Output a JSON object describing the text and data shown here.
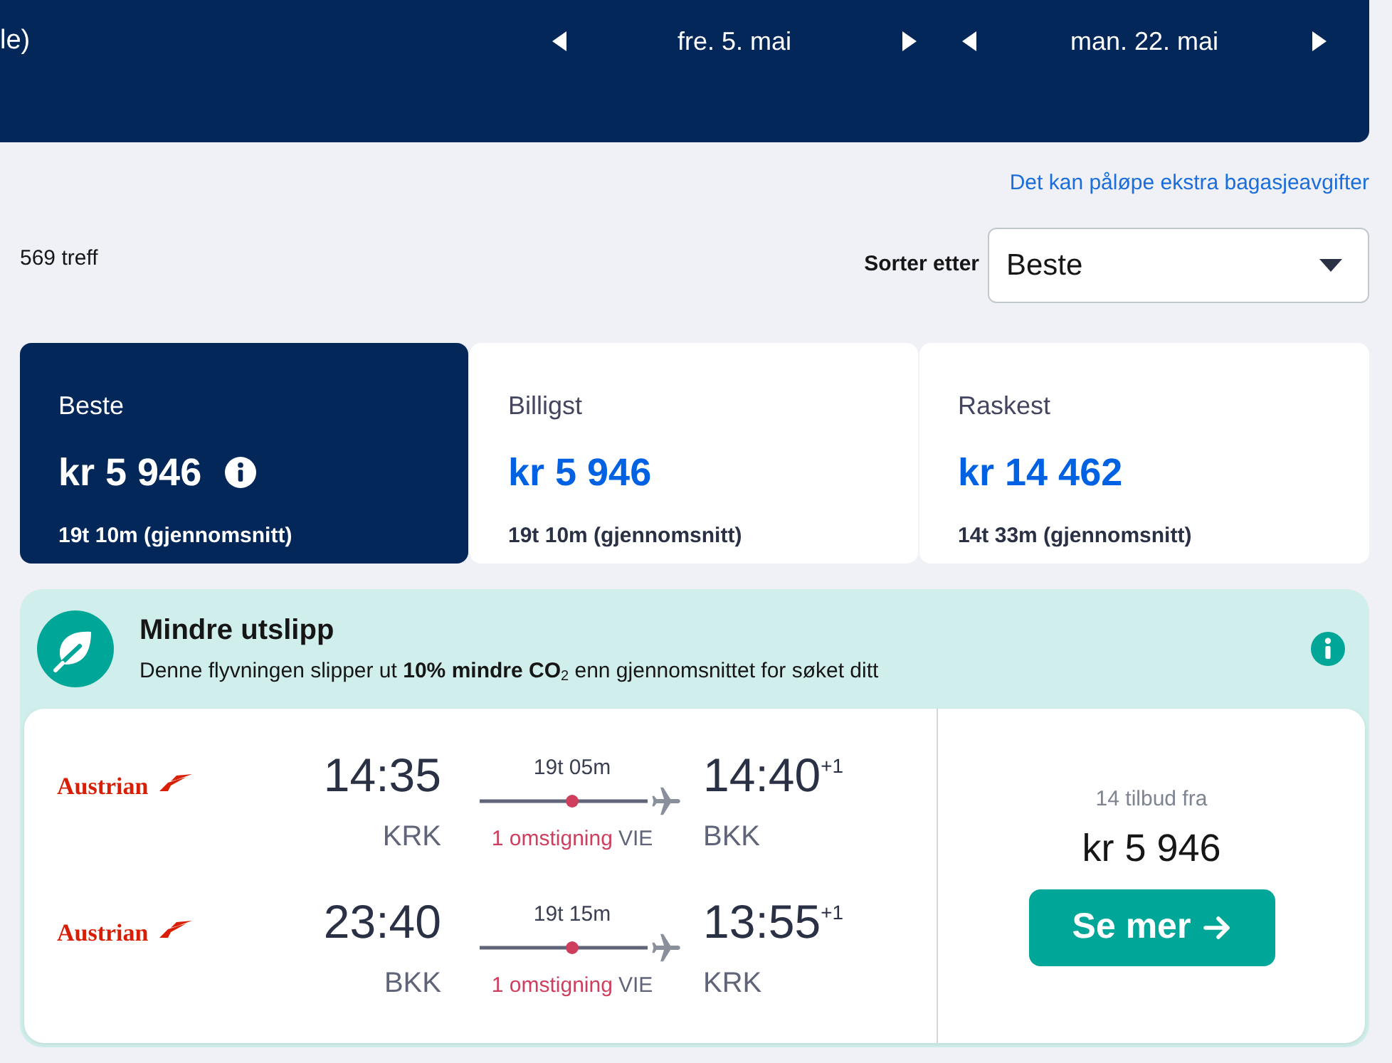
{
  "header": {
    "title_fragment": "le)",
    "dates": [
      {
        "label": "fre. 5. mai"
      },
      {
        "label": "man. 22. mai"
      }
    ]
  },
  "baggage_notice": "Det kan påløpe ekstra bagasjeavgifter",
  "result_count": "569 treff",
  "sort": {
    "label": "Sorter etter",
    "value": "Beste"
  },
  "tabs": [
    {
      "label": "Beste",
      "price": "kr 5 946",
      "duration": "19t 10m (gjennomsnitt)",
      "info": true,
      "selected": true
    },
    {
      "label": "Billigst",
      "price": "kr 5 946",
      "duration": "19t 10m (gjennomsnitt)",
      "info": false,
      "selected": false
    },
    {
      "label": "Raskest",
      "price": "kr 14 462",
      "duration": "14t 33m (gjennomsnitt)",
      "info": false,
      "selected": false
    }
  ],
  "eco_banner": {
    "title": "Mindre utslipp",
    "text": "Denne flyvningen slipper ut **10% mindre CO**$_{2}$ enn gjennomsnittet for søket ditt"
  },
  "result": {
    "legs": [
      {
        "airline": "Austrian",
        "depart_time": "14:35",
        "depart_airport": "KRK",
        "duration": "19t 05m",
        "stops": "1 omstigning",
        "via": "VIE",
        "arrive_time": "14:40",
        "day_offset": "+1",
        "arrive_airport": "BKK"
      },
      {
        "airline": "Austrian",
        "depart_time": "23:40",
        "depart_airport": "BKK",
        "duration": "19t 15m",
        "stops": "1 omstigning",
        "via": "VIE",
        "arrive_time": "13:55",
        "day_offset": "+1",
        "arrive_airport": "KRK"
      }
    ],
    "offers": "14 tilbud fra",
    "price": "kr 5 946",
    "button": "Se mer"
  }
}
